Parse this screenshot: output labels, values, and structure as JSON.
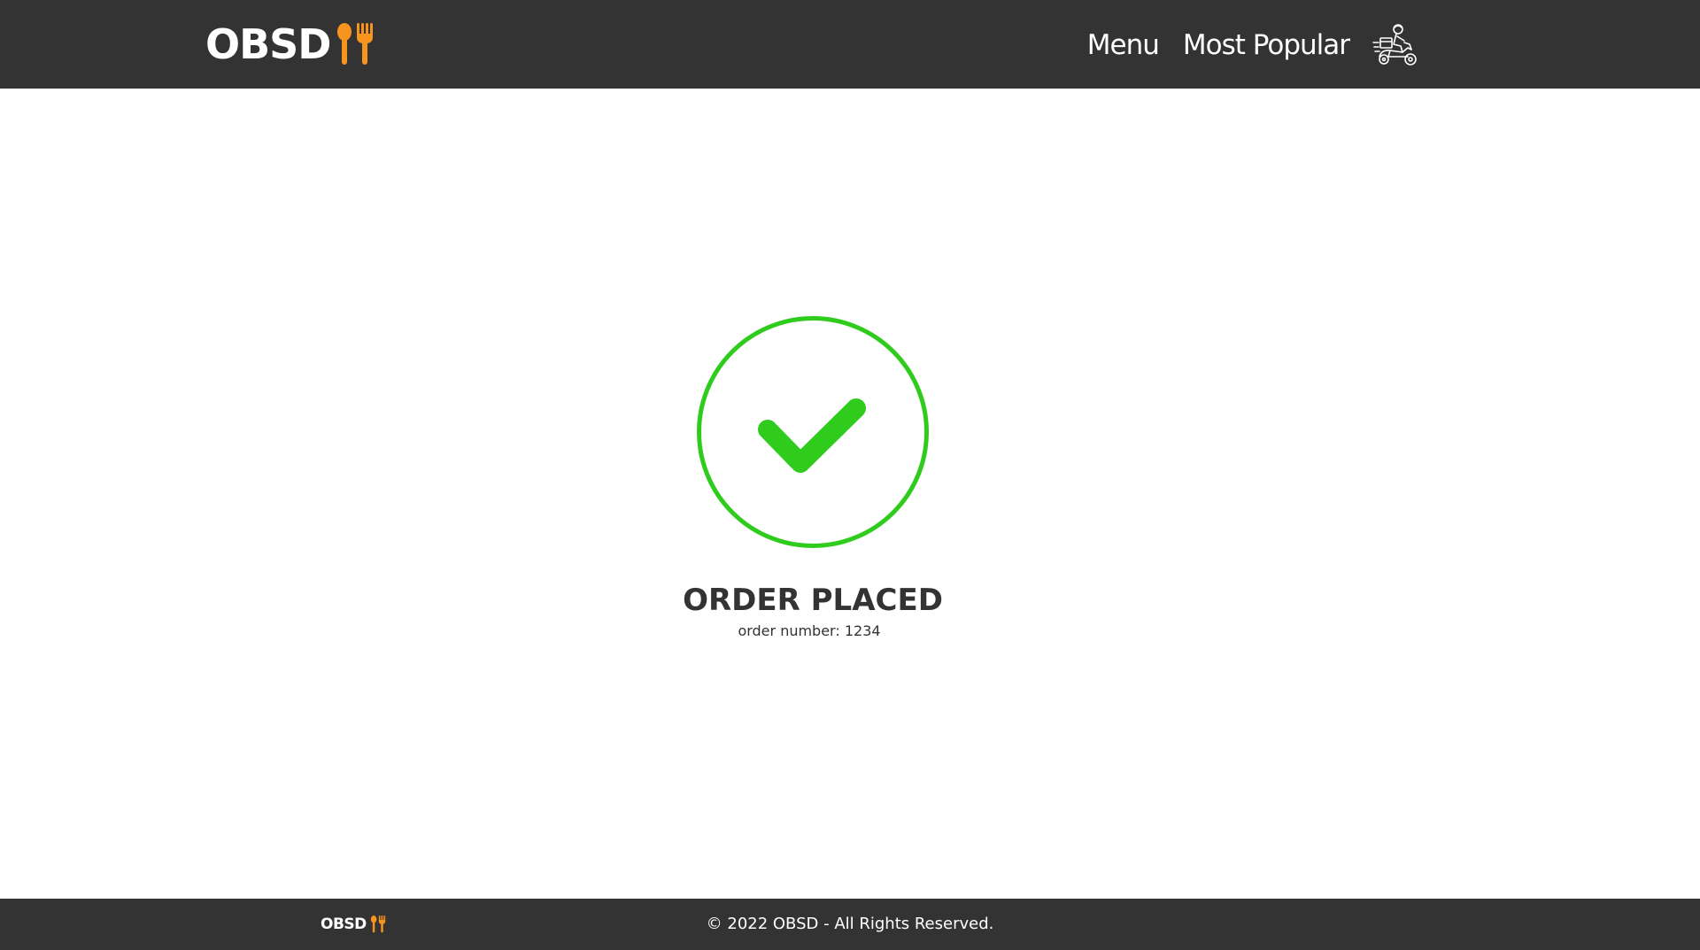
{
  "header": {
    "logo_text": "OBSD",
    "logo_icon": "spoon-fork-icon",
    "nav": [
      {
        "label": "Menu"
      },
      {
        "label": "Most Popular"
      }
    ],
    "delivery_icon": "delivery-scooter-icon"
  },
  "main": {
    "status_icon": "check-circle-icon",
    "title": "ORDER PLACED",
    "order_number_label": "order number:",
    "order_number": "1234"
  },
  "footer": {
    "logo_text": "OBSD",
    "copyright": "© 2022 OBSD - All Rights Reserved."
  },
  "colors": {
    "header_bg": "#333333",
    "accent_orange": "#F7941D",
    "success_green": "#2FCC1E",
    "text_dark": "#333333"
  }
}
